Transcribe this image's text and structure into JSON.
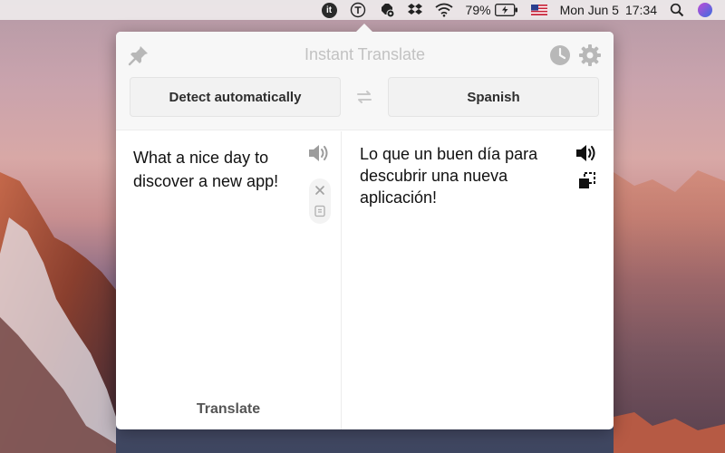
{
  "menubar": {
    "app_icon_label": "it",
    "battery": "79%",
    "date": "Mon Jun 5",
    "time": "17:34",
    "icons": [
      "instant-translate-icon",
      "typeeto-icon",
      "nut-gear-icon",
      "dropbox-icon",
      "wifi-icon",
      "battery-icon",
      "us-flag-icon",
      "spotlight-search-icon",
      "siri-icon"
    ]
  },
  "popover": {
    "title": "Instant Translate",
    "source_language": "Detect automatically",
    "target_language": "Spanish",
    "source_text": "What a nice day to discover a new app!",
    "target_text": "Lo que un buen día para descubrir una nueva aplicación!",
    "translate_label": "Translate",
    "colors": {
      "title": "#c2c2c2",
      "icon_gray": "#b8b8b8",
      "header_bg": "#f7f7f7"
    }
  }
}
